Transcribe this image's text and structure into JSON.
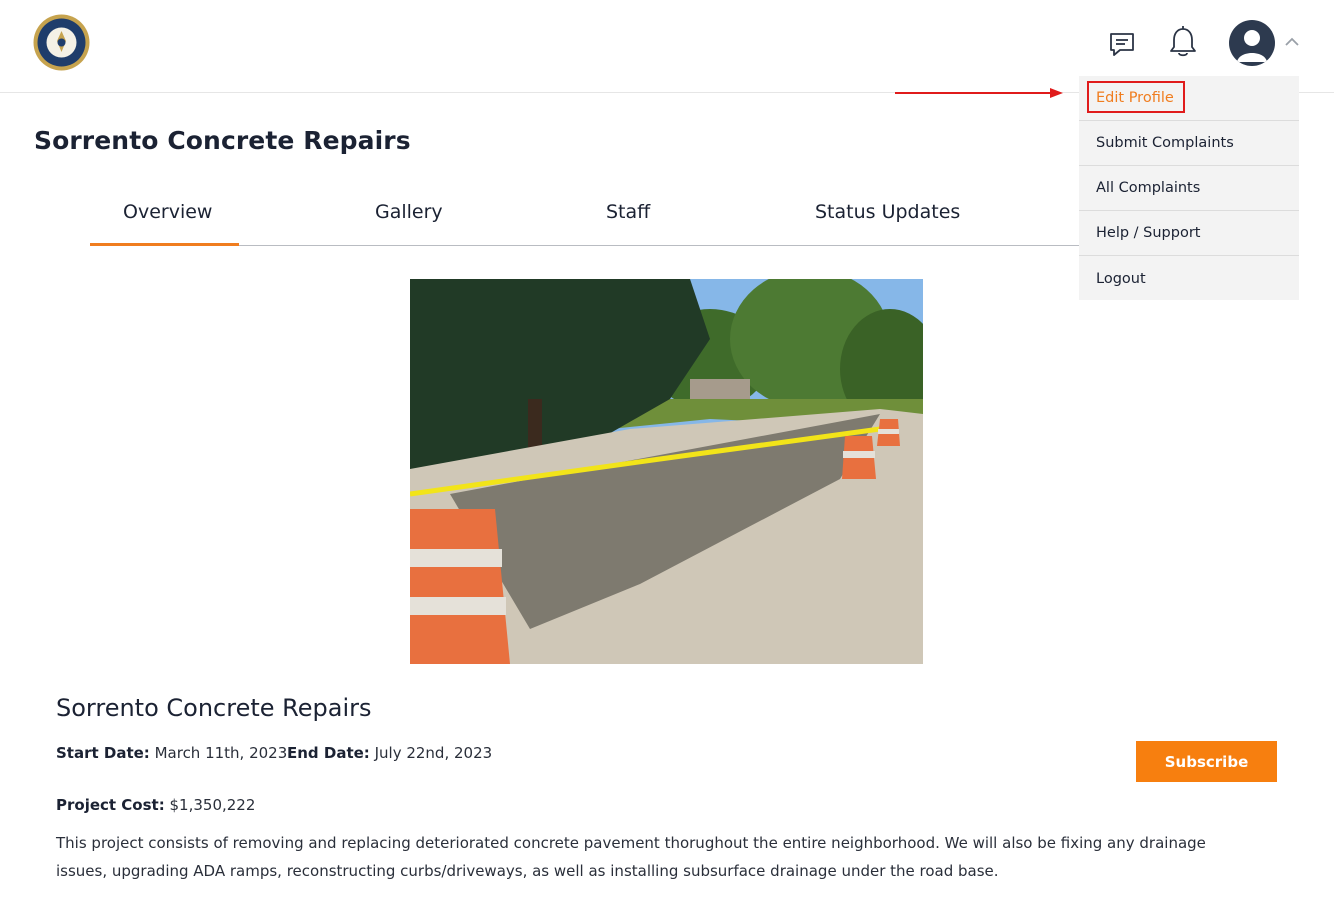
{
  "header": {
    "logo_name": "city-seal-logo",
    "icons": [
      "message-icon",
      "bell-icon",
      "user-avatar-icon",
      "chevron-up-icon"
    ]
  },
  "page": {
    "title": "Sorrento Concrete Repairs"
  },
  "tabs": [
    {
      "label": "Overview",
      "active": true
    },
    {
      "label": "Gallery",
      "active": false
    },
    {
      "label": "Staff",
      "active": false
    },
    {
      "label": "Status Updates",
      "active": false
    }
  ],
  "project": {
    "title": "Sorrento Concrete Repairs",
    "start_label": "Start Date:",
    "start_value": "March 11th, 2023",
    "end_label": "End Date:",
    "end_value": "July 22nd, 2023",
    "cost_label": "Project Cost:",
    "cost_value": "$1,350,222",
    "description": "This project consists of removing and replacing deteriorated concrete pavement thorughout the entire neighborhood. We will also be fixing any drainage issues, upgrading ADA ramps, reconstructing curbs/driveways, as well as installing subsurface drainage under the road base.",
    "subscribe_label": "Subscribe"
  },
  "user_menu": {
    "items": [
      {
        "label": "Edit Profile"
      },
      {
        "label": "Submit Complaints"
      },
      {
        "label": "All Complaints"
      },
      {
        "label": "Help / Support"
      },
      {
        "label": "Logout"
      }
    ]
  },
  "colors": {
    "accent": "#f77f0f",
    "highlight": "#e01b1b",
    "text": "#1b2233"
  }
}
